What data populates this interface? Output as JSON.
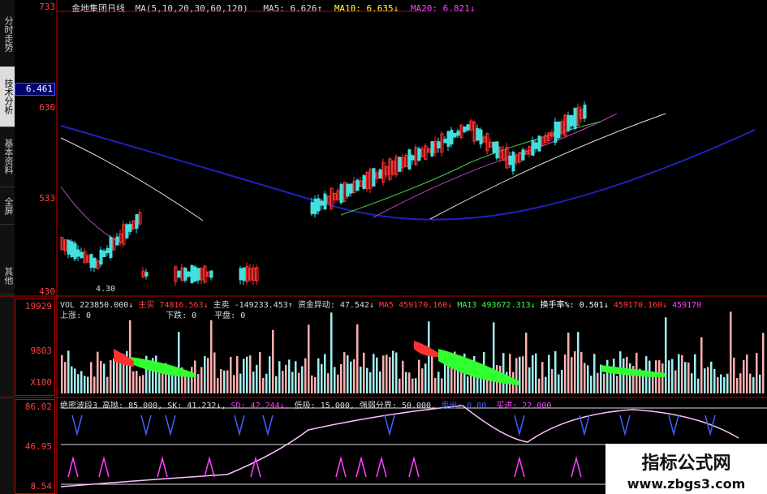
{
  "sidebar": [
    {
      "label": "分时走势",
      "active": false
    },
    {
      "label": "技术分析",
      "active": true
    },
    {
      "label": "基本资料",
      "active": false
    },
    {
      "label": "全屏",
      "active": false
    },
    {
      "label": "其他",
      "active": false
    }
  ],
  "header": {
    "title": "金地集团日线",
    "ma_def": "MA(5,10,20,30,60,120)",
    "ma5": "MA5: 6.626↑",
    "ma10": "MA10: 6.635↓",
    "ma20": "MA20: 6.821↓"
  },
  "price_scale": {
    "top": "733",
    "current": "6.461",
    "l1": "636",
    "l2": "533",
    "l3": "430",
    "low_label": "4.30"
  },
  "vol": {
    "scale_top": "19929",
    "scale_mid": "9803",
    "scale_bot": "X100",
    "items": [
      {
        "text": "VOL 223850.000↓",
        "color": "#dddddd"
      },
      {
        "text": "主买 74816.563↓",
        "color": "#ff4040"
      },
      {
        "text": "主卖 -149233.453↑",
        "color": "#dddddd"
      },
      {
        "text": "资金异动: 47.542↓",
        "color": "#dddddd"
      },
      {
        "text": "MA5 459170.160↓",
        "color": "#ff4040"
      },
      {
        "text": "MA13 493672.313↓",
        "color": "#40ff40"
      },
      {
        "text": "换手率%: 0.501↓",
        "color": "#ffffff"
      },
      {
        "text": "459170.160↓",
        "color": "#ff4040"
      },
      {
        "text": "459170",
        "color": "#ff40ff"
      }
    ],
    "row2": [
      "上涨: 0",
      "下跌: 0",
      "平盘: 0"
    ]
  },
  "osc": {
    "scale_top": "86.02",
    "scale_mid": "46.95",
    "scale_bot": "8.54",
    "items": [
      {
        "text": "绝密波段3",
        "color": "#dddddd"
      },
      {
        "text": "高抛: 85.000,",
        "color": "#dddddd"
      },
      {
        "text": "SK: 41.232↓,",
        "color": "#dddddd"
      },
      {
        "text": "SD: 42.244↓,",
        "color": "#ff40ff"
      },
      {
        "text": "低吸: 15.000,",
        "color": "#dddddd"
      },
      {
        "text": "强弱分界: 50.000,",
        "color": "#dddddd"
      },
      {
        "text": "卖出: 0.00,",
        "color": "#4060ff"
      },
      {
        "text": "买进: 22.000",
        "color": "#ff40ff"
      }
    ]
  },
  "watermark": {
    "line1": "指标公式网",
    "line2": "www.zbgs3.com"
  },
  "colors": {
    "up": "#ff3030",
    "down": "#40e0e0",
    "panel_border": "#c00000",
    "ma_blue": "#2020c0"
  }
}
